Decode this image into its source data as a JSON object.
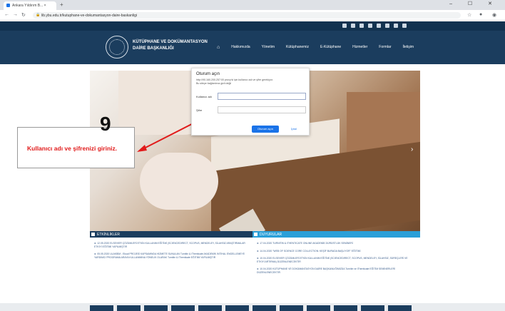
{
  "browser": {
    "tab_title": "Ankara Yıldırım B... ×",
    "new_tab": "+",
    "url": "lib.ybu.edu.tr/kutuphane-ve-dokumantasyon-daire-baskanligi",
    "win_buttons": "–  ☐  ✕"
  },
  "header": {
    "logo_text_line1": "KÜTÜPHANE VE DOKÜMANTASYON",
    "logo_text_line2": "DAİRE BAŞKANLIĞI",
    "nav": [
      "Hakkımızda",
      "Yönetim",
      "Kütüphanemiz",
      "E-Kütüphane",
      "Hizmetler",
      "Formlar",
      "İletişim"
    ]
  },
  "login": {
    "title": "Oturum açın",
    "subtitle1": "http://90.160.200.257:00 proxy'si için kullanıcı adı ve şifre gerekiyor.",
    "subtitle2": "Bu siteye bağlantınız gizli değil",
    "username_label": "Kullanıcı adı",
    "password_label": "Şifre",
    "submit_label": "Oturum açın",
    "cancel_label": "İptal"
  },
  "callout": {
    "number": "9",
    "text": "Kullanıcı adı ve şifrenizi giriniz."
  },
  "events": {
    "heading": "ETKİNLİKLER",
    "items": [
      "► 12.05.2020 ELSEVIER ÇÖZÜMLERİ ETKİN KULLANIM EĞİTİMİ (SCIENCEDIRECT, SCOPUS, MENDELEY, SİLAHSIZ ARAŞTIRMALAR ETKİYİ EĞİTİMİ YAPILMIŞTIR",
      "► 05.05.2020 ULAKBİM - Ekual PROJESİ KAPSAMINDA HİZMETE SUNULAN Turnitin & iThenticate AKADEMİK INTİHAL ENGELLEMEYE YARDIMCI PROGRAMA ARAYA KULLANIMINA YÖNELİK OLARAK Turnitin & iThenticate EĞİTİMİ YAPILMIŞTIR"
    ]
  },
  "announcements": {
    "heading": "DUYURULAR",
    "items": [
      "► 17.04.2020 TURNITIN & iTHENTICATE ONLINE AKADEMİK DÜRÜSTLÜK SEMİNERİ",
      "► 14.04.2020 \"WEB OF SCIENCE CORE COLLECTION: KEŞİF BURADA BAŞLIYOR\" EĞİTİMİ",
      "► 10.04.2020 ELSEVIER ÇÖZÜMLERİ ETKİN KULLANIM EĞİTİMİ (SCIENCEDIRECT, SCOPUS, MENDELEY, SİLAHSIZ, SÜREÇLERİ VE ETKİYİ ARTIRMA) DÜZENLENECEKTİR",
      "► 10.04.2020 KÜTÜPHANE VE DOKÜMANTASYON DAİRE BAŞKANLIĞIMIZDA Turnitin ve iThenticate EĞİTİM SEMİNERLERİ DÜZENLENECEKTİR"
    ]
  },
  "colors": {
    "header": "#1b3d5e",
    "accent": "#2a9fd8",
    "callout_text": "#e11b1b"
  }
}
